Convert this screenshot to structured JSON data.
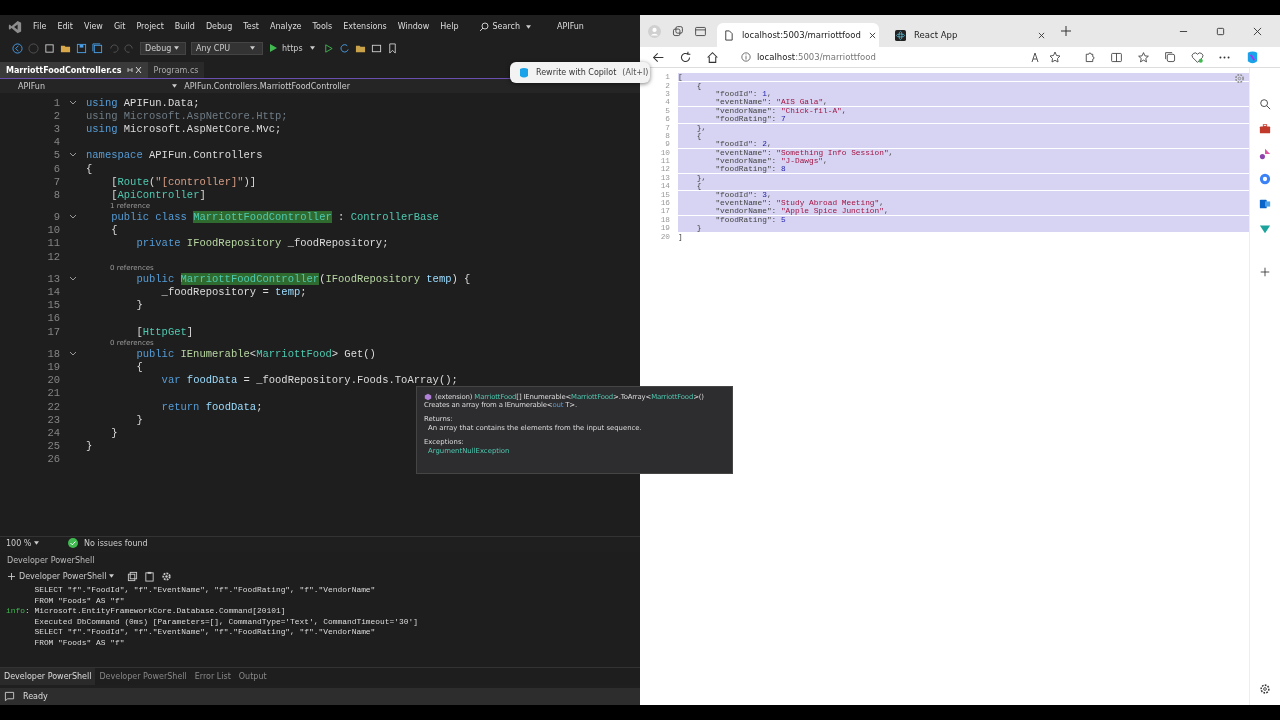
{
  "ide": {
    "menu": [
      "File",
      "Edit",
      "View",
      "Git",
      "Project",
      "Build",
      "Debug",
      "Test",
      "Analyze",
      "Tools",
      "Extensions",
      "Window",
      "Help"
    ],
    "search": "Search",
    "solution": "APIFun",
    "toolbar": {
      "configuration": "Debug",
      "platform": "Any CPU",
      "run_target": "https"
    },
    "tabs": [
      {
        "label": "MarriottFoodController.cs",
        "selected": true
      },
      {
        "label": "Program.cs",
        "selected": false
      }
    ],
    "nav": {
      "project": "APIFun",
      "member": "APIFun.Controllers.MarriottFoodController"
    },
    "copilot_popup": {
      "label": "Rewrite with Copilot",
      "shortcut": "(Alt+I)"
    },
    "code": [
      {
        "num": "1",
        "fold": true,
        "tokens": [
          {
            "text": "using",
            "kind": "kw"
          },
          {
            "text": " APIFun.Data;",
            "kind": "plain"
          }
        ]
      },
      {
        "num": "2",
        "fold": false,
        "tokens": [
          {
            "text": "using Microsoft.AspNetCore.Http;",
            "kind": "dim"
          }
        ]
      },
      {
        "num": "3",
        "fold": false,
        "tokens": [
          {
            "text": "using",
            "kind": "kw"
          },
          {
            "text": " Microsoft.AspNetCore.Mvc;",
            "kind": "plain"
          }
        ]
      },
      {
        "num": "4",
        "fold": false
      },
      {
        "num": "5",
        "fold": true,
        "tokens": [
          {
            "text": "namespace",
            "kind": "kw"
          },
          {
            "text": " APIFun.Controllers",
            "kind": "plain"
          }
        ]
      },
      {
        "num": "6",
        "fold": false,
        "tokens": [
          {
            "text": "{",
            "kind": "plain"
          }
        ]
      },
      {
        "num": "7",
        "fold": false,
        "tokens": [
          {
            "text": "    [",
            "kind": "plain"
          },
          {
            "text": "Route",
            "kind": "type"
          },
          {
            "text": "(",
            "kind": "plain"
          },
          {
            "text": "\"[controller]\"",
            "kind": "str"
          },
          {
            "text": ")]",
            "kind": "plain"
          }
        ]
      },
      {
        "num": "8",
        "fold": false,
        "tokens": [
          {
            "text": "    [",
            "kind": "plain"
          },
          {
            "text": "ApiController",
            "kind": "type"
          },
          {
            "text": "]",
            "kind": "plain"
          }
        ]
      },
      {
        "num": "9",
        "fold": true,
        "lens": "1 reference",
        "tokens": [
          {
            "text": "    public class ",
            "kind": "kw"
          },
          {
            "text": "MarriottFoodController",
            "kind": "hl"
          },
          {
            "text": " : ",
            "kind": "plain"
          },
          {
            "text": "ControllerBase",
            "kind": "type"
          }
        ]
      },
      {
        "num": "10",
        "fold": false,
        "tokens": [
          {
            "text": "    {",
            "kind": "plain"
          }
        ]
      },
      {
        "num": "11",
        "fold": false,
        "tokens": [
          {
            "text": "        private ",
            "kind": "kw"
          },
          {
            "text": "IFoodRepository",
            "kind": "iface"
          },
          {
            "text": " _foodRepository;",
            "kind": "plain"
          }
        ]
      },
      {
        "num": "12",
        "fold": false
      },
      {
        "num": "13",
        "fold": true,
        "lens": "0 references",
        "tokens": [
          {
            "text": "        public ",
            "kind": "kw"
          },
          {
            "text": "MarriottFoodController",
            "kind": "hl"
          },
          {
            "text": "(",
            "kind": "plain"
          },
          {
            "text": "IFoodRepository ",
            "kind": "iface"
          },
          {
            "text": "temp",
            "kind": "param"
          },
          {
            "text": ") {",
            "kind": "plain"
          }
        ]
      },
      {
        "num": "14",
        "fold": false,
        "tokens": [
          {
            "text": "            _foodRepository = ",
            "kind": "plain"
          },
          {
            "text": "temp",
            "kind": "param"
          },
          {
            "text": ";",
            "kind": "plain"
          }
        ]
      },
      {
        "num": "15",
        "fold": false,
        "tokens": [
          {
            "text": "        }",
            "kind": "plain"
          }
        ]
      },
      {
        "num": "16",
        "fold": false
      },
      {
        "num": "17",
        "fold": false,
        "tokens": [
          {
            "text": "        [",
            "kind": "plain"
          },
          {
            "text": "HttpGet",
            "kind": "type"
          },
          {
            "text": "]",
            "kind": "plain"
          }
        ]
      },
      {
        "num": "18",
        "fold": true,
        "lens": "0 references",
        "tokens": [
          {
            "text": "        public ",
            "kind": "kw"
          },
          {
            "text": "IEnumerable",
            "kind": "iface"
          },
          {
            "text": "<",
            "kind": "plain"
          },
          {
            "text": "MarriottFood",
            "kind": "type"
          },
          {
            "text": "> Get()",
            "kind": "plain"
          }
        ]
      },
      {
        "num": "19",
        "fold": false,
        "tokens": [
          {
            "text": "        {",
            "kind": "plain"
          }
        ]
      },
      {
        "num": "20",
        "fold": false,
        "tokens": [
          {
            "text": "            var ",
            "kind": "kw"
          },
          {
            "text": "foodData",
            "kind": "param"
          },
          {
            "text": " = _foodRepository.Foods.ToArray();",
            "kind": "plain"
          }
        ]
      },
      {
        "num": "21",
        "fold": false
      },
      {
        "num": "22",
        "fold": false,
        "tokens": [
          {
            "text": "            return ",
            "kind": "kw"
          },
          {
            "text": "foodData",
            "kind": "param"
          },
          {
            "text": ";",
            "kind": "plain"
          }
        ]
      },
      {
        "num": "23",
        "fold": false,
        "tokens": [
          {
            "text": "        }",
            "kind": "plain"
          }
        ]
      },
      {
        "num": "24",
        "fold": false,
        "tokens": [
          {
            "text": "    }",
            "kind": "plain"
          }
        ]
      },
      {
        "num": "25",
        "fold": false,
        "tokens": [
          {
            "text": "}",
            "kind": "plain"
          }
        ]
      },
      {
        "num": "26",
        "fold": false
      }
    ],
    "tooltip": {
      "signature": [
        {
          "text": "(extension) ",
          "kind": "plain"
        },
        {
          "text": "MarriottFood",
          "kind": "type"
        },
        {
          "text": "[] IEnumerable<",
          "kind": "plain"
        },
        {
          "text": "MarriottFood",
          "kind": "type"
        },
        {
          "text": ">.ToArray<",
          "kind": "plain"
        },
        {
          "text": "MarriottFood",
          "kind": "type"
        },
        {
          "text": ">()",
          "kind": "plain"
        }
      ],
      "summary": [
        {
          "text": "Creates an array from a IEnumerable<",
          "kind": "plain"
        },
        {
          "text": "out",
          "kind": "kw"
        },
        {
          "text": " T>.",
          "kind": "plain"
        }
      ],
      "returns_label": "Returns:",
      "returns": "An array that contains the elements from the input sequence.",
      "exceptions_label": "Exceptions:",
      "exception": "ArgumentNullException"
    },
    "zoom": "100 %",
    "issues": "No issues found",
    "terminal": {
      "title": "Developer PowerShell",
      "shell": "Developer PowerShell",
      "lines": [
        {
          "text": "      SELECT \"f\".\"FoodId\", \"f\".\"EventName\", \"f\".\"FoodRating\", \"f\".\"VendorName\""
        },
        {
          "text": "      FROM \"Foods\" AS \"f\""
        },
        {
          "prefix": "info",
          "text": ": Microsoft.EntityFrameworkCore.Database.Command[20101]"
        },
        {
          "text": "      Executed DbCommand (0ms) [Parameters=[], CommandType='Text', CommandTimeout='30']"
        },
        {
          "text": "      SELECT \"f\".\"FoodId\", \"f\".\"EventName\", \"f\".\"FoodRating\", \"f\".\"VendorName\""
        },
        {
          "text": "      FROM \"Foods\" AS \"f\""
        }
      ]
    },
    "panel_tabs": [
      {
        "label": "Developer PowerShell",
        "selected": true
      },
      {
        "label": "Developer PowerShell",
        "selected": false
      },
      {
        "label": "Error List",
        "selected": false
      },
      {
        "label": "Output",
        "selected": false
      }
    ],
    "status": "Ready"
  },
  "browser": {
    "tabs": [
      {
        "label": "localhost:5003/marriottfood",
        "selected": true
      },
      {
        "label": "React App",
        "selected": false
      }
    ],
    "address": {
      "host": "localhost",
      "path": ":5003/marriottfood"
    },
    "json_lines": [
      {
        "num": "1",
        "selected": true,
        "tokens": [
          {
            "text": "[",
            "kind": "punct"
          }
        ]
      },
      {
        "num": "2",
        "selected": true,
        "tokens": [
          {
            "text": "    {",
            "kind": "punct"
          }
        ]
      },
      {
        "num": "3",
        "selected": true,
        "tokens": [
          {
            "text": "        \"foodId\": ",
            "kind": "key"
          },
          {
            "text": "1",
            "kind": "num"
          },
          {
            "text": ",",
            "kind": "punct"
          }
        ]
      },
      {
        "num": "4",
        "selected": true,
        "tokens": [
          {
            "text": "        \"eventName\": ",
            "kind": "key"
          },
          {
            "text": "\"AIS Gala\"",
            "kind": "str"
          },
          {
            "text": ",",
            "kind": "punct"
          }
        ]
      },
      {
        "num": "5",
        "selected": true,
        "tokens": [
          {
            "text": "        \"vendorName\": ",
            "kind": "key"
          },
          {
            "text": "\"Chick-fil-A\"",
            "kind": "str"
          },
          {
            "text": ",",
            "kind": "punct"
          }
        ]
      },
      {
        "num": "6",
        "selected": true,
        "tokens": [
          {
            "text": "        \"foodRating\": ",
            "kind": "key"
          },
          {
            "text": "7",
            "kind": "num"
          }
        ]
      },
      {
        "num": "7",
        "selected": true,
        "tokens": [
          {
            "text": "    },",
            "kind": "punct"
          }
        ]
      },
      {
        "num": "8",
        "selected": true,
        "tokens": [
          {
            "text": "    {",
            "kind": "punct"
          }
        ]
      },
      {
        "num": "9",
        "selected": true,
        "tokens": [
          {
            "text": "        \"foodId\": ",
            "kind": "key"
          },
          {
            "text": "2",
            "kind": "num"
          },
          {
            "text": ",",
            "kind": "punct"
          }
        ]
      },
      {
        "num": "10",
        "selected": true,
        "tokens": [
          {
            "text": "        \"eventName\": ",
            "kind": "key"
          },
          {
            "text": "\"Something Info Session\"",
            "kind": "str"
          },
          {
            "text": ",",
            "kind": "punct"
          }
        ]
      },
      {
        "num": "11",
        "selected": true,
        "tokens": [
          {
            "text": "        \"vendorName\": ",
            "kind": "key"
          },
          {
            "text": "\"J-Dawgs\"",
            "kind": "str"
          },
          {
            "text": ",",
            "kind": "punct"
          }
        ]
      },
      {
        "num": "12",
        "selected": true,
        "tokens": [
          {
            "text": "        \"foodRating\": ",
            "kind": "key"
          },
          {
            "text": "8",
            "kind": "num"
          }
        ]
      },
      {
        "num": "13",
        "selected": true,
        "tokens": [
          {
            "text": "    },",
            "kind": "punct"
          }
        ]
      },
      {
        "num": "14",
        "selected": true,
        "tokens": [
          {
            "text": "    {",
            "kind": "punct"
          }
        ]
      },
      {
        "num": "15",
        "selected": true,
        "tokens": [
          {
            "text": "        \"foodId\": ",
            "kind": "key"
          },
          {
            "text": "3",
            "kind": "num"
          },
          {
            "text": ",",
            "kind": "punct"
          }
        ]
      },
      {
        "num": "16",
        "selected": true,
        "tokens": [
          {
            "text": "        \"eventName\": ",
            "kind": "key"
          },
          {
            "text": "\"Study Abroad Meeting\"",
            "kind": "str"
          },
          {
            "text": ",",
            "kind": "punct"
          }
        ]
      },
      {
        "num": "17",
        "selected": true,
        "tokens": [
          {
            "text": "        \"vendorName\": ",
            "kind": "key"
          },
          {
            "text": "\"Apple Spice Junction\"",
            "kind": "str"
          },
          {
            "text": ",",
            "kind": "punct"
          }
        ]
      },
      {
        "num": "18",
        "selected": true,
        "tokens": [
          {
            "text": "        \"foodRating\": ",
            "kind": "key"
          },
          {
            "text": "5",
            "kind": "num"
          }
        ]
      },
      {
        "num": "19",
        "selected": true,
        "tokens": [
          {
            "text": "    }",
            "kind": "punct"
          }
        ]
      },
      {
        "num": "20",
        "selected": false,
        "tokens": [
          {
            "text": "]",
            "kind": "punct"
          }
        ]
      }
    ]
  }
}
